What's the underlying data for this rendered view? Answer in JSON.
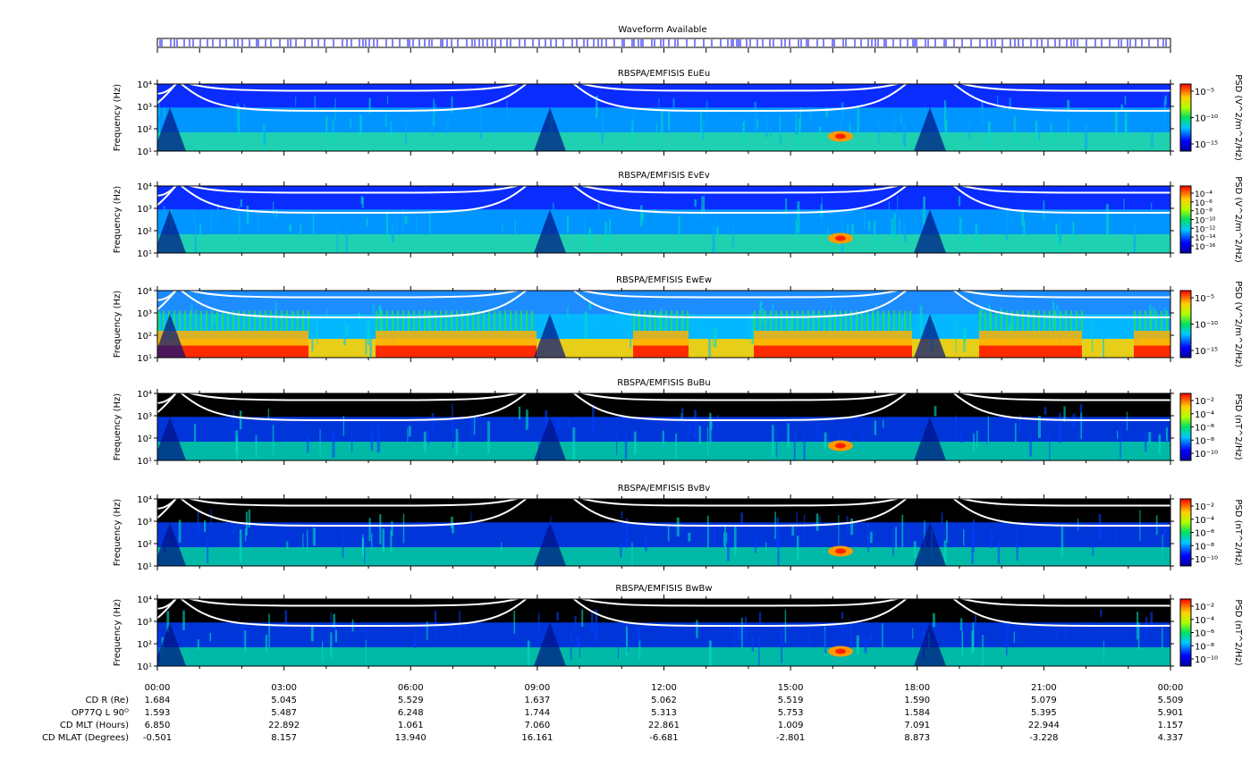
{
  "figure": {
    "waveform_title": "Waveform Available",
    "colors": {
      "waveform_tick": "#0000ff",
      "background": "#ffffff",
      "frame": "#000000",
      "fce_lines": "#ffffff"
    }
  },
  "chart_data": [
    {
      "type": "heatmap",
      "title": "RBSPA/EMFISIS  EuEu",
      "ylabel": "Frequency (Hz)",
      "y_ticks": [
        "10¹",
        "10²",
        "10³",
        "10⁴"
      ],
      "ylim": [
        10,
        10000
      ],
      "y_scale": "log",
      "colorbar_label": "PSD (V^2/m^2/Hz)",
      "colorbar_ticks": [
        "10⁻⁵",
        "10⁻¹⁰",
        "10⁻¹⁵"
      ],
      "style": "electric"
    },
    {
      "type": "heatmap",
      "title": "RBSPA/EMFISIS  EvEv",
      "ylabel": "Frequency (Hz)",
      "y_ticks": [
        "10¹",
        "10²",
        "10³",
        "10⁴"
      ],
      "ylim": [
        10,
        10000
      ],
      "y_scale": "log",
      "colorbar_label": "PSD (V^2/m^2/Hz)",
      "colorbar_ticks": [
        "10⁻⁴",
        "10⁻⁶",
        "10⁻⁸",
        "10⁻¹⁰",
        "10⁻¹²",
        "10⁻¹⁴",
        "10⁻¹⁶"
      ],
      "style": "electric"
    },
    {
      "type": "heatmap",
      "title": "RBSPA/EMFISIS  EwEw",
      "ylabel": "Frequency (Hz)",
      "y_ticks": [
        "10¹",
        "10²",
        "10³",
        "10⁴"
      ],
      "ylim": [
        10,
        10000
      ],
      "y_scale": "log",
      "colorbar_label": "PSD (V^2/m^2/Hz)",
      "colorbar_ticks": [
        "10⁻⁵",
        "10⁻¹⁰",
        "10⁻¹⁵"
      ],
      "style": "ew"
    },
    {
      "type": "heatmap",
      "title": "RBSPA/EMFISIS  BuBu",
      "ylabel": "Frequency (Hz)",
      "y_ticks": [
        "10¹",
        "10²",
        "10³",
        "10⁴"
      ],
      "ylim": [
        10,
        10000
      ],
      "y_scale": "log",
      "colorbar_label": "PSD (nT^2/Hz)",
      "colorbar_ticks": [
        "10⁻²",
        "10⁻⁴",
        "10⁻⁶",
        "10⁻⁸",
        "10⁻¹⁰"
      ],
      "style": "magnetic"
    },
    {
      "type": "heatmap",
      "title": "RBSPA/EMFISIS  BvBv",
      "ylabel": "Frequency (Hz)",
      "y_ticks": [
        "10¹",
        "10²",
        "10³",
        "10⁴"
      ],
      "ylim": [
        10,
        10000
      ],
      "y_scale": "log",
      "colorbar_label": "PSD (nT^2/Hz)",
      "colorbar_ticks": [
        "10⁻²",
        "10⁻⁴",
        "10⁻⁶",
        "10⁻⁸",
        "10⁻¹⁰"
      ],
      "style": "magnetic"
    },
    {
      "type": "heatmap",
      "title": "RBSPA/EMFISIS  BwBw",
      "ylabel": "Frequency (Hz)",
      "y_ticks": [
        "10¹",
        "10²",
        "10³",
        "10⁴"
      ],
      "ylim": [
        10,
        10000
      ],
      "y_scale": "log",
      "colorbar_label": "PSD (nT^2/Hz)",
      "colorbar_ticks": [
        "10⁻²",
        "10⁻⁴",
        "10⁻⁶",
        "10⁻⁸",
        "10⁻¹⁰"
      ],
      "style": "magnetic"
    }
  ],
  "x_axis": {
    "tick_labels": [
      "00:00",
      "03:00",
      "06:00",
      "09:00",
      "12:00",
      "15:00",
      "18:00",
      "21:00",
      "00:00"
    ],
    "minor_per_major": 3
  },
  "ephemeris": {
    "rows": [
      {
        "label": "CD R (Re)",
        "values": [
          "1.684",
          "5.045",
          "5.529",
          "1.637",
          "5.062",
          "5.519",
          "1.590",
          "5.079",
          "5.509"
        ]
      },
      {
        "label": "OP77Q L 90ᴼ",
        "values": [
          "1.593",
          "5.487",
          "6.248",
          "1.744",
          "5.313",
          "5.753",
          "1.584",
          "5.395",
          "5.901"
        ]
      },
      {
        "label": "CD MLT (Hours)",
        "values": [
          "6.850",
          "22.892",
          "1.061",
          "7.060",
          "22.861",
          "1.009",
          "7.091",
          "22.944",
          "1.157"
        ]
      },
      {
        "label": "CD MLAT (Degrees)",
        "values": [
          "-0.501",
          "8.157",
          "13.940",
          "16.161",
          "-6.681",
          "-2.801",
          "8.873",
          "-3.228",
          "4.337"
        ]
      }
    ]
  }
}
